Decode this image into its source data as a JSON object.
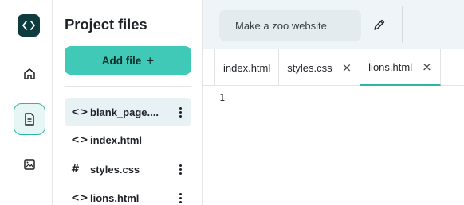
{
  "rail": {
    "logo_icon": "code-brackets-icon",
    "items": [
      {
        "icon": "home-icon",
        "active": false
      },
      {
        "icon": "file-icon",
        "active": true
      },
      {
        "icon": "image-icon",
        "active": false
      }
    ]
  },
  "panel": {
    "title": "Project files",
    "add_button_label": "Add file",
    "add_button_symbol": "+",
    "files": [
      {
        "icon": "<>",
        "name": "blank_page....",
        "selected": true,
        "has_menu": true
      },
      {
        "icon": "<>",
        "name": "index.html",
        "selected": false,
        "has_menu": false
      },
      {
        "icon": "#",
        "name": "styles.css",
        "selected": false,
        "has_menu": true
      },
      {
        "icon": "<>",
        "name": "lions.html",
        "selected": false,
        "has_menu": true
      }
    ]
  },
  "editor": {
    "prompt_text": "Make a zoo website",
    "tabs": [
      {
        "label": "index.html",
        "closable": false,
        "active": false
      },
      {
        "label": "styles.css",
        "closable": true,
        "active": false
      },
      {
        "label": "lions.html",
        "closable": true,
        "active": true
      }
    ],
    "close_symbol": "×",
    "line_number": "1"
  },
  "colors": {
    "accent": "#3fc9b6",
    "logo_bg": "#0e3b3e",
    "selected_row": "#e8f1f4"
  }
}
